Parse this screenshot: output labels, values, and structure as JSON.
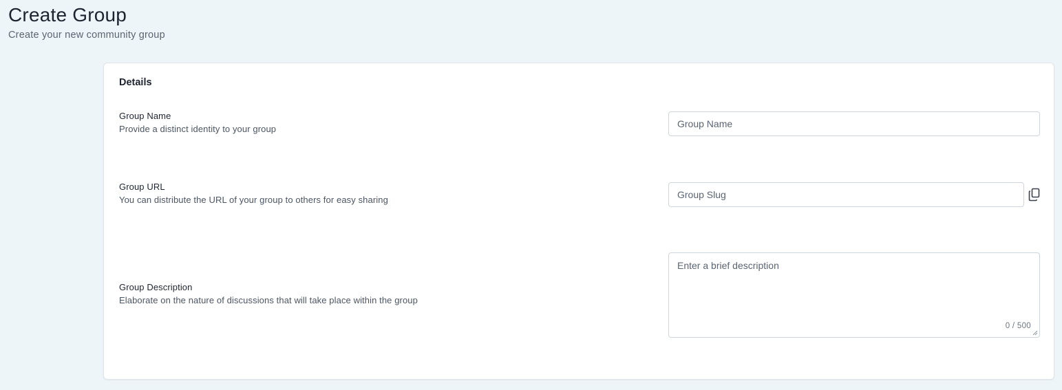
{
  "header": {
    "title": "Create Group",
    "subtitle": "Create your new community group"
  },
  "card": {
    "title": "Details"
  },
  "fields": {
    "name": {
      "label": "Group Name",
      "help": "Provide a distinct identity to your group",
      "placeholder": "Group Name",
      "value": ""
    },
    "url": {
      "label": "Group URL",
      "help": "You can distribute the URL of your group to others for easy sharing",
      "placeholder": "Group Slug",
      "value": "",
      "copy_icon": "copy-icon"
    },
    "description": {
      "label": "Group Description",
      "help": "Elaborate on the nature of discussions that will take place within the group",
      "placeholder": "Enter a brief description",
      "value": "",
      "char_count": "0 / 500"
    }
  }
}
